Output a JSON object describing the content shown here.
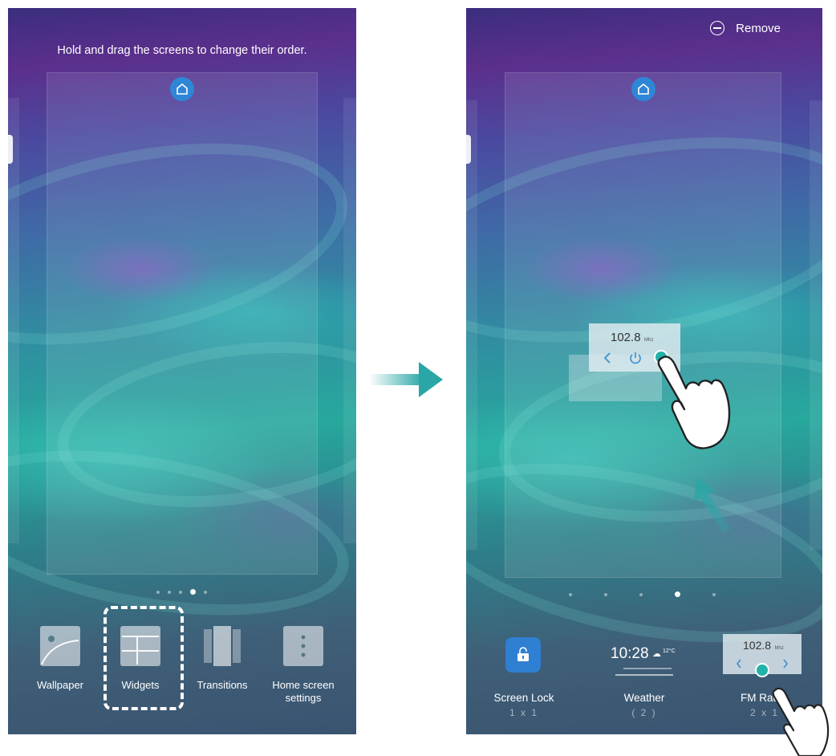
{
  "left_screen": {
    "caption": "Hold and drag the screens to change their order.",
    "page_indicator": {
      "count": 5,
      "active_index": 3
    },
    "menu": [
      {
        "label": "Wallpaper",
        "icon": "wallpaper-icon"
      },
      {
        "label": "Widgets",
        "icon": "widgets-icon",
        "highlighted": true
      },
      {
        "label": "Transitions",
        "icon": "transitions-icon"
      },
      {
        "label": "Home screen settings",
        "icon": "settings-icon"
      }
    ]
  },
  "right_screen": {
    "remove_label": "Remove",
    "dragged_widget": {
      "frequency": "102.8",
      "unit": "Mhz"
    },
    "page_indicator": {
      "count": 5,
      "active_index": 3
    },
    "widget_tray": [
      {
        "label": "Screen Lock",
        "size": "1 x 1"
      },
      {
        "label": "Weather",
        "size": "( 2 )",
        "time": "10:28",
        "temp": "12°C"
      },
      {
        "label": "FM Radi",
        "size": "2 x 1",
        "frequency": "102.8",
        "unit": "Mhz"
      }
    ]
  },
  "colors": {
    "accent": "#22b2a9",
    "home_blue": "#2f86d6",
    "arrow_teal": "#2aa6a6"
  }
}
